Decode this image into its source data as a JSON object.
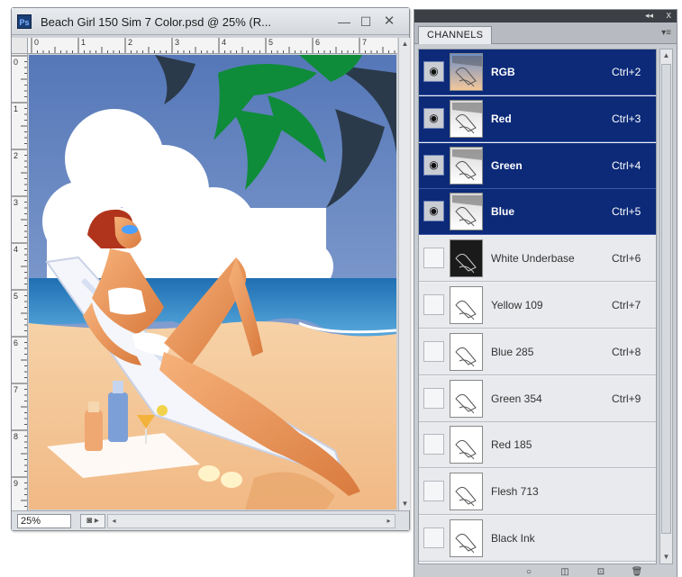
{
  "document": {
    "title": "Beach Girl 150 Sim 7 Color.psd @ 25% (R...",
    "app_badge": "Ps",
    "zoom": "25%",
    "ruler_top_marks": [
      "0",
      "1",
      "2",
      "3",
      "4",
      "5",
      "6",
      "7"
    ],
    "ruler_left_marks": [
      "0",
      "1",
      "2",
      "3",
      "4",
      "5",
      "6",
      "7",
      "8",
      "9"
    ]
  },
  "panel": {
    "tab_label": "CHANNELS",
    "collapse_glyph": "◂◂",
    "close_glyph": "x",
    "menu_glyph": "▾≡"
  },
  "channels": [
    {
      "name": "RGB",
      "shortcut": "Ctrl+2",
      "visible": true,
      "selected": true
    },
    {
      "name": "Red",
      "shortcut": "Ctrl+3",
      "visible": true,
      "selected": true
    },
    {
      "name": "Green",
      "shortcut": "Ctrl+4",
      "visible": true,
      "selected": true
    },
    {
      "name": "Blue",
      "shortcut": "Ctrl+5",
      "visible": true,
      "selected": true
    },
    {
      "name": "White Underbase",
      "shortcut": "Ctrl+6",
      "visible": false,
      "selected": false
    },
    {
      "name": "Yellow 109",
      "shortcut": "Ctrl+7",
      "visible": false,
      "selected": false
    },
    {
      "name": "Blue 285",
      "shortcut": "Ctrl+8",
      "visible": false,
      "selected": false
    },
    {
      "name": "Green 354",
      "shortcut": "Ctrl+9",
      "visible": false,
      "selected": false
    },
    {
      "name": "Red 185",
      "shortcut": "",
      "visible": false,
      "selected": false
    },
    {
      "name": "Flesh 713",
      "shortcut": "",
      "visible": false,
      "selected": false
    },
    {
      "name": "Black Ink",
      "shortcut": "",
      "visible": false,
      "selected": false
    }
  ],
  "colors": {
    "selected_row": "#0c2a78",
    "sky": "#6f8fc6",
    "sea": "#2f86c6",
    "sand": "#f3c79b",
    "leaf_green": "#0f8c3a",
    "leaf_dark": "#2b3a4a"
  }
}
